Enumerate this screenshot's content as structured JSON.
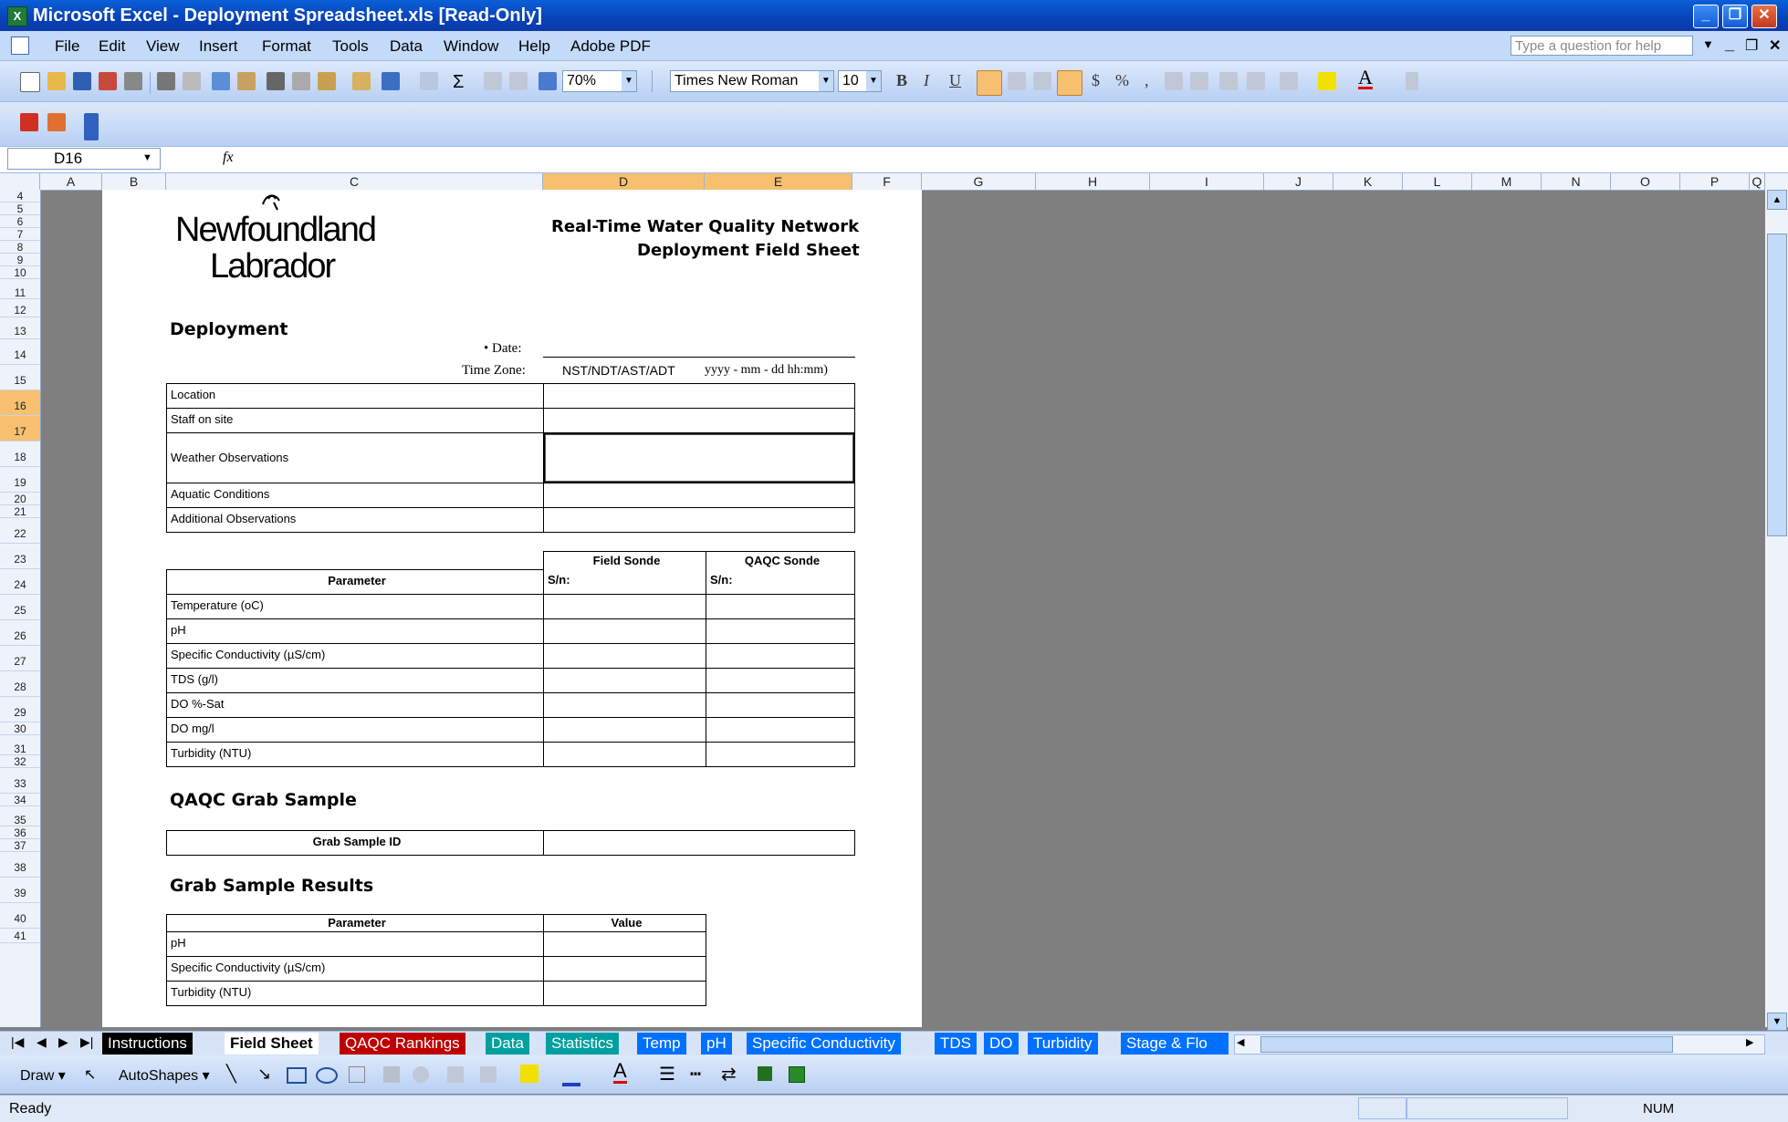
{
  "window": {
    "title": "Microsoft Excel - Deployment Spreadsheet.xls  [Read-Only]"
  },
  "menu": {
    "items": [
      "File",
      "Edit",
      "View",
      "Insert",
      "Format",
      "Tools",
      "Data",
      "Window",
      "Help",
      "Adobe PDF"
    ],
    "help_placeholder": "Type a question for help"
  },
  "toolbar": {
    "zoom": "70%",
    "font": "Times New Roman",
    "font_size": "10"
  },
  "formula": {
    "cell_ref": "D16",
    "fx": "fx",
    "value": ""
  },
  "columns": [
    "A",
    "B",
    "C",
    "D",
    "E",
    "F",
    "G",
    "H",
    "I",
    "J",
    "K",
    "L",
    "M",
    "N",
    "O",
    "P",
    "Q"
  ],
  "rows": [
    "4",
    "5",
    "6",
    "7",
    "8",
    "9",
    "10",
    "11",
    "12",
    "13",
    "14",
    "15",
    "16",
    "17",
    "18",
    "19",
    "20",
    "21",
    "22",
    "23",
    "24",
    "25",
    "26",
    "27",
    "28",
    "29",
    "30",
    "31",
    "32",
    "33",
    "34",
    "35",
    "36",
    "37",
    "38",
    "39",
    "40",
    "41"
  ],
  "sheet": {
    "logo_line1": "Newfoundland",
    "logo_line2": "Labrador",
    "header_title1": "Real-Time Water Quality Network",
    "header_title2": "Deployment Field Sheet",
    "deployment_heading": "Deployment",
    "date_label": "• Date:",
    "timezone_label": "Time Zone:",
    "timezone_value": "NST/NDT/AST/ADT",
    "date_format": "yyyy - mm - dd hh:mm)",
    "deployment_rows": [
      "Location",
      "Staff on site",
      "Weather Observations",
      "Aquatic Conditions",
      "Additional Observations"
    ],
    "sonde_header_field": "Field Sonde",
    "sonde_header_qaqc": "QAQC Sonde",
    "parameter_header": "Parameter",
    "sn_label_field": "S/n:",
    "sn_label_qaqc": "S/n:",
    "parameters": [
      "Temperature (oC)",
      "pH",
      "Specific Conductivity (µS/cm)",
      "TDS (g/l)",
      "DO %-Sat",
      "DO mg/l",
      "Turbidity (NTU)"
    ],
    "qaqc_heading": "QAQC Grab Sample",
    "grab_sample_id_label": "Grab Sample ID",
    "grab_results_heading": "Grab Sample Results",
    "grab_param_header": "Parameter",
    "grab_value_header": "Value",
    "grab_params": [
      "pH",
      "Specific Conductivity (µS/cm)",
      "Turbidity (NTU)"
    ]
  },
  "tabs": [
    {
      "label": "Instructions",
      "color": "#000000"
    },
    {
      "label": "Field Sheet",
      "color": "#ffffff",
      "active": true
    },
    {
      "label": "QAQC Rankings",
      "color": "#c00000"
    },
    {
      "label": "Data",
      "color": "#00a0a0"
    },
    {
      "label": "Statistics",
      "color": "#00a0a0"
    },
    {
      "label": "Temp",
      "color": "#0070ff"
    },
    {
      "label": "pH",
      "color": "#0070ff"
    },
    {
      "label": "Specific Conductivity",
      "color": "#0070ff"
    },
    {
      "label": "TDS",
      "color": "#0070ff"
    },
    {
      "label": "DO",
      "color": "#0070ff"
    },
    {
      "label": "Turbidity",
      "color": "#0070ff"
    },
    {
      "label": "Stage & Flo",
      "color": "#0070ff"
    }
  ],
  "drawbar": {
    "draw": "Draw ▾",
    "autoshapes": "AutoShapes ▾"
  },
  "status": {
    "left": "Ready",
    "num": "NUM"
  }
}
